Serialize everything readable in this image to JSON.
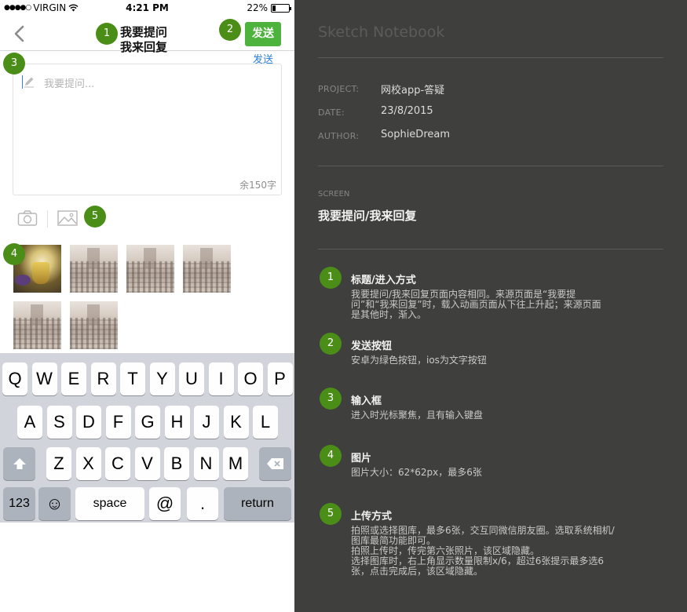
{
  "status_bar": {
    "signal": "●●●●○",
    "carrier": "VIRGIN",
    "time": "4:21 PM",
    "battery": "22%",
    "battery_level": 0.22
  },
  "nav": {
    "title_line1": "我要提问",
    "title_line2": "我来回复",
    "send_button": "发送",
    "send_text": "发送"
  },
  "input": {
    "placeholder": "我要提问...",
    "counter": "余150字"
  },
  "keyboard": {
    "row1": [
      "Q",
      "W",
      "E",
      "R",
      "T",
      "Y",
      "U",
      "I",
      "O",
      "P"
    ],
    "row2": [
      "A",
      "S",
      "D",
      "F",
      "G",
      "H",
      "J",
      "K",
      "L"
    ],
    "row3": [
      "Z",
      "X",
      "C",
      "V",
      "B",
      "N",
      "M"
    ],
    "num_key": "123",
    "emoji_key": "☺",
    "space_key": "space",
    "at_key": "@",
    "dot_key": ".",
    "return_key": "return"
  },
  "badges": [
    "1",
    "2",
    "3",
    "4",
    "5"
  ],
  "notebook": {
    "title": "Sketch Notebook",
    "project_label": "PROJECT:",
    "project_value": "网校app-答疑",
    "date_label": "DATE:",
    "date_value": "23/8/2015",
    "author_label": "AUTHOR:",
    "author_value": "SophieDream",
    "screen_label": "SCREEN",
    "screen_name": "我要提问/我来回复",
    "notes": [
      {
        "num": "1",
        "title": "标题/进入方式",
        "body": "我要提问/我来回复页面内容相同。来源页面是“我要提\n问”和“我来回复”时，载入动画页面从下往上升起；来源页面\n是其他时，渐入。"
      },
      {
        "num": "2",
        "title": "发送按钮",
        "body": "安卓为绿色按钮，ios为文字按钮"
      },
      {
        "num": "3",
        "title": "输入框",
        "body": "进入时光标聚焦，且有输入键盘"
      },
      {
        "num": "4",
        "title": "图片",
        "body": "图片大小：62*62px，最多6张"
      },
      {
        "num": "5",
        "title": "上传方式",
        "body": "拍照或选择图库，最多6张，交互同微信朋友圈。选取系统相机/\n图库最简功能即可。\n拍照上传时，传完第六张照片，该区域隐藏。\n选择图库时，右上角显示数量限制x/6，超过6张提示最多选6\n张，点击完成后，该区域隐藏。"
      }
    ]
  }
}
